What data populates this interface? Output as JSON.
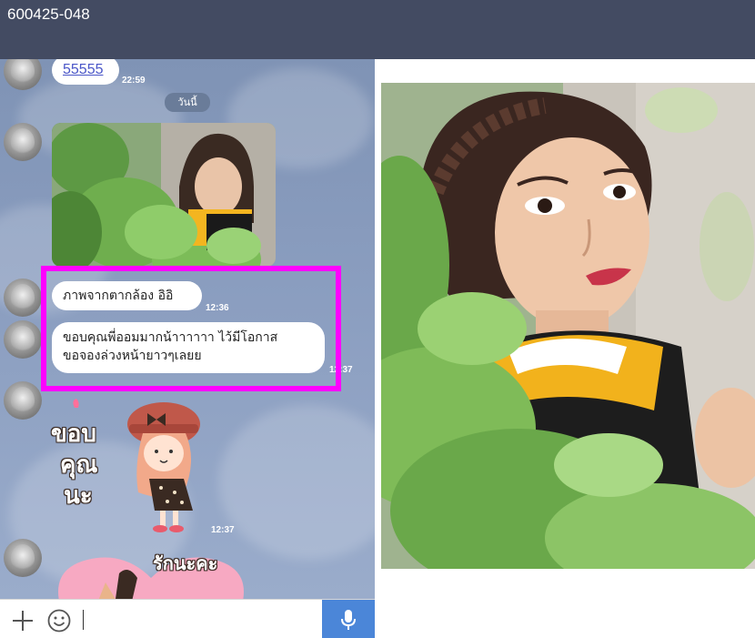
{
  "header": {
    "title": "600425-048"
  },
  "chat": {
    "date_separator": "วันนี้",
    "messages": [
      {
        "type": "text",
        "text": "55555",
        "time": "22:59"
      },
      {
        "type": "image",
        "time": ""
      },
      {
        "type": "text",
        "text": "ภาพจากตากล้อง อิอิ",
        "time": "12:36"
      },
      {
        "type": "text",
        "lines": [
          "ขอบคุณพี่ออมมากน้าาาาาา ไว้มีโอกาส",
          "ขอจองล่วงหน้ายาวๆเลยย"
        ],
        "time": "12:37"
      },
      {
        "type": "sticker",
        "lines": [
          "ขอบ",
          "คุณ",
          "นะ"
        ],
        "time": "12:37"
      },
      {
        "type": "sticker",
        "lines": [
          "รักนะคะ"
        ]
      }
    ]
  },
  "colors": {
    "header": "#434b62",
    "highlight": "#ff00ff",
    "mic_button": "#4b86d8"
  },
  "icons": {
    "add": "plus-icon",
    "emoji": "smile-icon",
    "voice": "mic-icon"
  }
}
